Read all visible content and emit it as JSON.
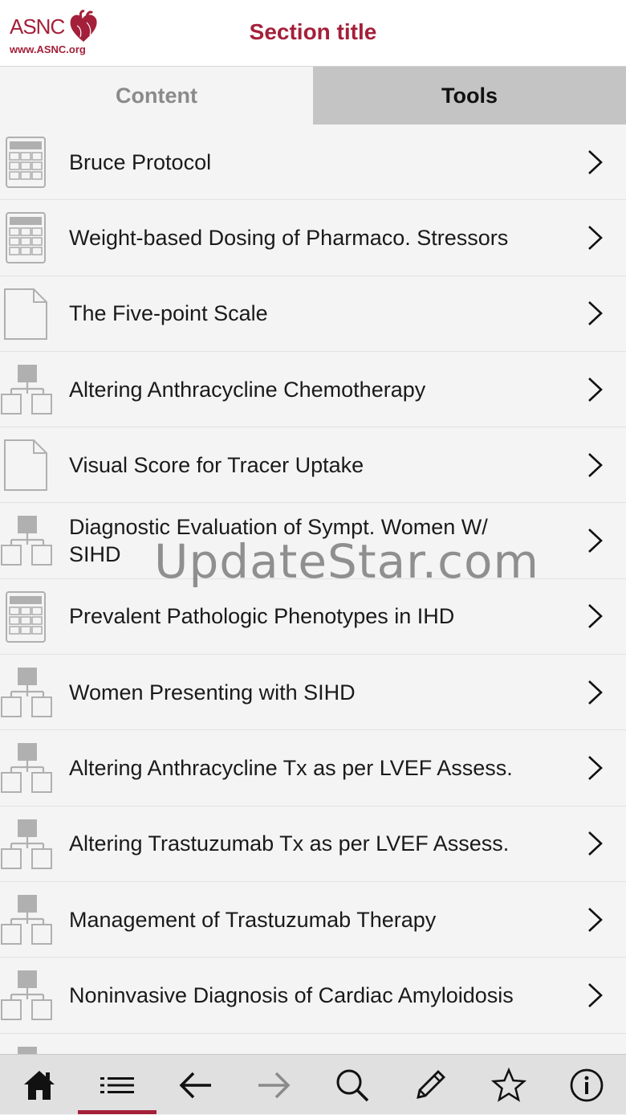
{
  "header": {
    "logo_text": "ASNC",
    "logo_url": "www.ASNC.org",
    "title": "Section title"
  },
  "tabs": [
    {
      "label": "Content",
      "active": false
    },
    {
      "label": "Tools",
      "active": true
    }
  ],
  "list": {
    "items": [
      {
        "label": "Bruce Protocol",
        "icon": "calculator-icon"
      },
      {
        "label": "Weight-based Dosing of Pharmaco. Stressors",
        "icon": "calculator-icon"
      },
      {
        "label": "The Five-point Scale",
        "icon": "document-icon"
      },
      {
        "label": "Altering Anthracycline Chemotherapy",
        "icon": "flowchart-icon"
      },
      {
        "label": "Visual Score for Tracer Uptake",
        "icon": "document-icon"
      },
      {
        "label": "Diagnostic Evaluation of Sympt. Women W/ SIHD",
        "icon": "flowchart-icon"
      },
      {
        "label": "Prevalent Pathologic Phenotypes in IHD",
        "icon": "calculator-icon"
      },
      {
        "label": "Women Presenting with SIHD",
        "icon": "flowchart-icon"
      },
      {
        "label": "Altering Anthracycline Tx as per LVEF Assess.",
        "icon": "flowchart-icon"
      },
      {
        "label": "Altering Trastuzumab Tx as per LVEF Assess.",
        "icon": "flowchart-icon"
      },
      {
        "label": "Management of Trastuzumab Therapy",
        "icon": "flowchart-icon"
      },
      {
        "label": "Noninvasive Diagnosis of Cardiac Amyloidosis",
        "icon": "flowchart-icon"
      },
      {
        "label": "",
        "icon": "flowchart-icon"
      }
    ]
  },
  "watermark": "UpdateStar.com",
  "bottom_nav": [
    {
      "icon": "home-icon"
    },
    {
      "icon": "list-icon",
      "active": true
    },
    {
      "icon": "back-arrow-icon"
    },
    {
      "icon": "forward-arrow-icon"
    },
    {
      "icon": "search-icon"
    },
    {
      "icon": "pencil-icon"
    },
    {
      "icon": "star-icon"
    },
    {
      "icon": "info-icon"
    }
  ],
  "colors": {
    "brand": "#a4203a",
    "tab_active_bg": "#c4c4c4",
    "background": "#f4f4f4",
    "icon_gray": "#b0b0b0"
  }
}
